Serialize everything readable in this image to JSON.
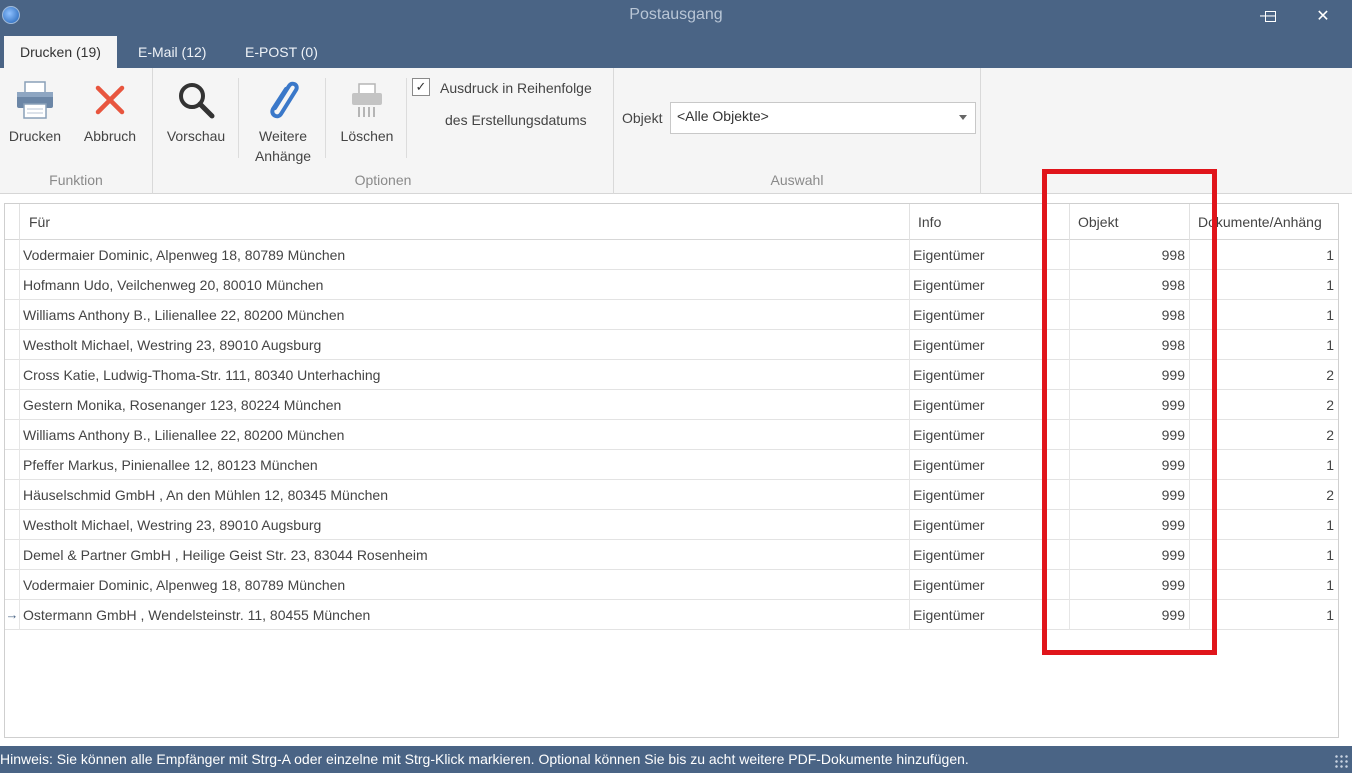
{
  "window": {
    "title": "Postausgang",
    "minimize_glyph": "—",
    "maximize_glyph": "☐",
    "close_glyph": "✕"
  },
  "tabs": [
    {
      "label": "Drucken (19)",
      "active": true
    },
    {
      "label": "E-Mail (12)",
      "active": false
    },
    {
      "label": "E-POST (0)",
      "active": false
    }
  ],
  "ribbon": {
    "funktion": {
      "label": "Funktion",
      "buttons": [
        {
          "label": "Drucken",
          "icon": "printer-icon"
        },
        {
          "label": "Abbruch",
          "icon": "cancel-x-icon"
        }
      ]
    },
    "optionen": {
      "label": "Optionen",
      "buttons": [
        {
          "label": "Vorschau",
          "icon": "magnifier-icon"
        },
        {
          "label_line1": "Weitere",
          "label_line2": "Anhänge",
          "icon": "paperclip-icon"
        },
        {
          "label": "Löschen",
          "icon": "shredder-icon"
        }
      ],
      "checkbox": {
        "checked": true,
        "label_line1": "Ausdruck in Reihenfolge",
        "label_line2": "des Erstellungsdatums"
      }
    },
    "auswahl": {
      "label": "Auswahl",
      "objekt_label": "Objekt",
      "objekt_value": "<Alle Objekte>"
    }
  },
  "grid": {
    "columns": [
      "Für",
      "Info",
      "Objekt",
      "Dokumente/Anhäng"
    ],
    "rows": [
      {
        "fuer": "Vodermaier Dominic, Alpenweg 18, 80789 München",
        "info": "Eigentümer",
        "objekt": "998",
        "dokumente": "1"
      },
      {
        "fuer": "Hofmann Udo, Veilchenweg 20, 80010 München",
        "info": "Eigentümer",
        "objekt": "998",
        "dokumente": "1"
      },
      {
        "fuer": "Williams Anthony B., Lilienallee 22, 80200 München",
        "info": "Eigentümer",
        "objekt": "998",
        "dokumente": "1"
      },
      {
        "fuer": "Westholt Michael, Westring 23, 89010 Augsburg",
        "info": "Eigentümer",
        "objekt": "998",
        "dokumente": "1"
      },
      {
        "fuer": "Cross Katie, Ludwig-Thoma-Str. 111, 80340 Unterhaching",
        "info": "Eigentümer",
        "objekt": "999",
        "dokumente": "2"
      },
      {
        "fuer": "Gestern Monika, Rosenanger 123, 80224 München",
        "info": "Eigentümer",
        "objekt": "999",
        "dokumente": "2"
      },
      {
        "fuer": "Williams Anthony B., Lilienallee 22, 80200 München",
        "info": "Eigentümer",
        "objekt": "999",
        "dokumente": "2"
      },
      {
        "fuer": "Pfeffer Markus, Pinienallee 12, 80123 München",
        "info": "Eigentümer",
        "objekt": "999",
        "dokumente": "1"
      },
      {
        "fuer": "Häuselschmid GmbH , An den Mühlen 12, 80345 München",
        "info": "Eigentümer",
        "objekt": "999",
        "dokumente": "2"
      },
      {
        "fuer": "Westholt Michael, Westring 23, 89010 Augsburg",
        "info": "Eigentümer",
        "objekt": "999",
        "dokumente": "1"
      },
      {
        "fuer": "Demel & Partner GmbH , Heilige Geist Str. 23, 83044 Rosenheim",
        "info": "Eigentümer",
        "objekt": "999",
        "dokumente": "1"
      },
      {
        "fuer": "Vodermaier Dominic, Alpenweg 18, 80789 München",
        "info": "Eigentümer",
        "objekt": "999",
        "dokumente": "1"
      },
      {
        "fuer": "Ostermann GmbH , Wendelsteinstr. 11, 80455 München",
        "info": "Eigentümer",
        "objekt": "999",
        "dokumente": "1",
        "current": true
      }
    ],
    "current_row_marker": "→"
  },
  "status": {
    "hint": "Hinweis: Sie können alle Empfänger mit Strg-A oder einzelne mit Strg-Klick markieren. Optional  können Sie bis zu acht weitere PDF-Dokumente hinzufügen."
  },
  "colors": {
    "titlebar": "#4a6485",
    "ribbon_bg": "#f5f5f5",
    "highlight": "#e0151b"
  }
}
